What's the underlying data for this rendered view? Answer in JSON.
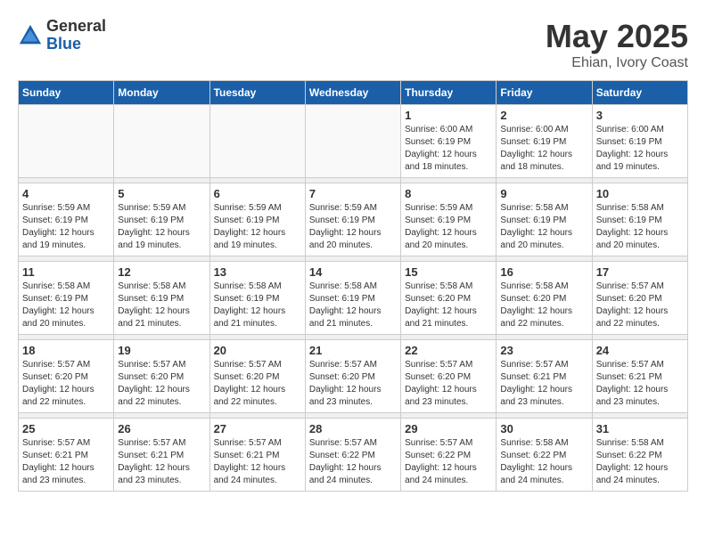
{
  "header": {
    "logo_general": "General",
    "logo_blue": "Blue",
    "month_title": "May 2025",
    "location": "Ehian, Ivory Coast"
  },
  "weekdays": [
    "Sunday",
    "Monday",
    "Tuesday",
    "Wednesday",
    "Thursday",
    "Friday",
    "Saturday"
  ],
  "weeks": [
    [
      {
        "day": "",
        "empty": true
      },
      {
        "day": "",
        "empty": true
      },
      {
        "day": "",
        "empty": true
      },
      {
        "day": "",
        "empty": true
      },
      {
        "day": "1",
        "sunrise": "6:00 AM",
        "sunset": "6:19 PM",
        "daylight": "12 hours and 18 minutes."
      },
      {
        "day": "2",
        "sunrise": "6:00 AM",
        "sunset": "6:19 PM",
        "daylight": "12 hours and 18 minutes."
      },
      {
        "day": "3",
        "sunrise": "6:00 AM",
        "sunset": "6:19 PM",
        "daylight": "12 hours and 19 minutes."
      }
    ],
    [
      {
        "day": "4",
        "sunrise": "5:59 AM",
        "sunset": "6:19 PM",
        "daylight": "12 hours and 19 minutes."
      },
      {
        "day": "5",
        "sunrise": "5:59 AM",
        "sunset": "6:19 PM",
        "daylight": "12 hours and 19 minutes."
      },
      {
        "day": "6",
        "sunrise": "5:59 AM",
        "sunset": "6:19 PM",
        "daylight": "12 hours and 19 minutes."
      },
      {
        "day": "7",
        "sunrise": "5:59 AM",
        "sunset": "6:19 PM",
        "daylight": "12 hours and 20 minutes."
      },
      {
        "day": "8",
        "sunrise": "5:59 AM",
        "sunset": "6:19 PM",
        "daylight": "12 hours and 20 minutes."
      },
      {
        "day": "9",
        "sunrise": "5:58 AM",
        "sunset": "6:19 PM",
        "daylight": "12 hours and 20 minutes."
      },
      {
        "day": "10",
        "sunrise": "5:58 AM",
        "sunset": "6:19 PM",
        "daylight": "12 hours and 20 minutes."
      }
    ],
    [
      {
        "day": "11",
        "sunrise": "5:58 AM",
        "sunset": "6:19 PM",
        "daylight": "12 hours and 20 minutes."
      },
      {
        "day": "12",
        "sunrise": "5:58 AM",
        "sunset": "6:19 PM",
        "daylight": "12 hours and 21 minutes."
      },
      {
        "day": "13",
        "sunrise": "5:58 AM",
        "sunset": "6:19 PM",
        "daylight": "12 hours and 21 minutes."
      },
      {
        "day": "14",
        "sunrise": "5:58 AM",
        "sunset": "6:19 PM",
        "daylight": "12 hours and 21 minutes."
      },
      {
        "day": "15",
        "sunrise": "5:58 AM",
        "sunset": "6:20 PM",
        "daylight": "12 hours and 21 minutes."
      },
      {
        "day": "16",
        "sunrise": "5:58 AM",
        "sunset": "6:20 PM",
        "daylight": "12 hours and 22 minutes."
      },
      {
        "day": "17",
        "sunrise": "5:57 AM",
        "sunset": "6:20 PM",
        "daylight": "12 hours and 22 minutes."
      }
    ],
    [
      {
        "day": "18",
        "sunrise": "5:57 AM",
        "sunset": "6:20 PM",
        "daylight": "12 hours and 22 minutes."
      },
      {
        "day": "19",
        "sunrise": "5:57 AM",
        "sunset": "6:20 PM",
        "daylight": "12 hours and 22 minutes."
      },
      {
        "day": "20",
        "sunrise": "5:57 AM",
        "sunset": "6:20 PM",
        "daylight": "12 hours and 22 minutes."
      },
      {
        "day": "21",
        "sunrise": "5:57 AM",
        "sunset": "6:20 PM",
        "daylight": "12 hours and 23 minutes."
      },
      {
        "day": "22",
        "sunrise": "5:57 AM",
        "sunset": "6:20 PM",
        "daylight": "12 hours and 23 minutes."
      },
      {
        "day": "23",
        "sunrise": "5:57 AM",
        "sunset": "6:21 PM",
        "daylight": "12 hours and 23 minutes."
      },
      {
        "day": "24",
        "sunrise": "5:57 AM",
        "sunset": "6:21 PM",
        "daylight": "12 hours and 23 minutes."
      }
    ],
    [
      {
        "day": "25",
        "sunrise": "5:57 AM",
        "sunset": "6:21 PM",
        "daylight": "12 hours and 23 minutes."
      },
      {
        "day": "26",
        "sunrise": "5:57 AM",
        "sunset": "6:21 PM",
        "daylight": "12 hours and 23 minutes."
      },
      {
        "day": "27",
        "sunrise": "5:57 AM",
        "sunset": "6:21 PM",
        "daylight": "12 hours and 24 minutes."
      },
      {
        "day": "28",
        "sunrise": "5:57 AM",
        "sunset": "6:22 PM",
        "daylight": "12 hours and 24 minutes."
      },
      {
        "day": "29",
        "sunrise": "5:57 AM",
        "sunset": "6:22 PM",
        "daylight": "12 hours and 24 minutes."
      },
      {
        "day": "30",
        "sunrise": "5:58 AM",
        "sunset": "6:22 PM",
        "daylight": "12 hours and 24 minutes."
      },
      {
        "day": "31",
        "sunrise": "5:58 AM",
        "sunset": "6:22 PM",
        "daylight": "12 hours and 24 minutes."
      }
    ]
  ]
}
